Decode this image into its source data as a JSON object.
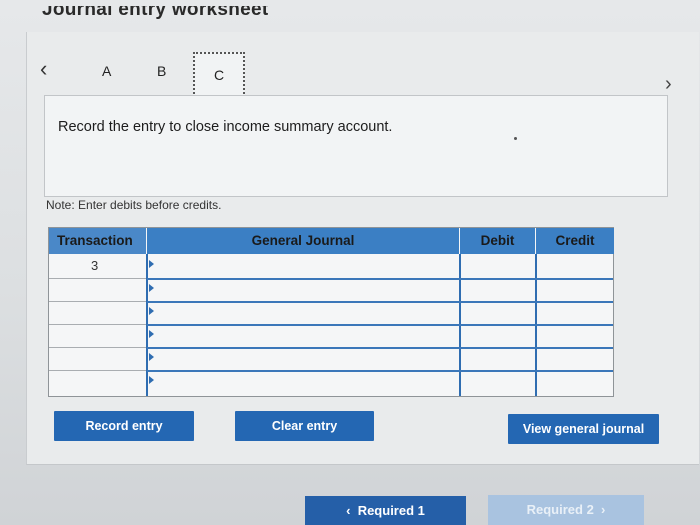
{
  "title": "Journal entry worksheet",
  "tabs": [
    "A",
    "B",
    "C"
  ],
  "nav": {
    "prev": "<",
    "next": ">"
  },
  "instruction": "Record the entry to close income summary account.",
  "note": "Note: Enter debits before credits.",
  "table": {
    "headers": {
      "transaction": "Transaction",
      "general_journal": "General Journal",
      "debit": "Debit",
      "credit": "Credit"
    },
    "rows": [
      {
        "transaction": "3",
        "general_journal": "",
        "debit": "",
        "credit": ""
      },
      {
        "transaction": "",
        "general_journal": "",
        "debit": "",
        "credit": ""
      },
      {
        "transaction": "",
        "general_journal": "",
        "debit": "",
        "credit": ""
      },
      {
        "transaction": "",
        "general_journal": "",
        "debit": "",
        "credit": ""
      },
      {
        "transaction": "",
        "general_journal": "",
        "debit": "",
        "credit": ""
      },
      {
        "transaction": "",
        "general_journal": "",
        "debit": "",
        "credit": ""
      }
    ]
  },
  "buttons": {
    "record": "Record entry",
    "clear": "Clear entry",
    "view": "View general journal",
    "required1": "Required 1",
    "required2": "Required 2"
  },
  "colors": {
    "accent": "#2467b3",
    "header": "#3b7fc4",
    "disabled": "#a9c3e0"
  }
}
